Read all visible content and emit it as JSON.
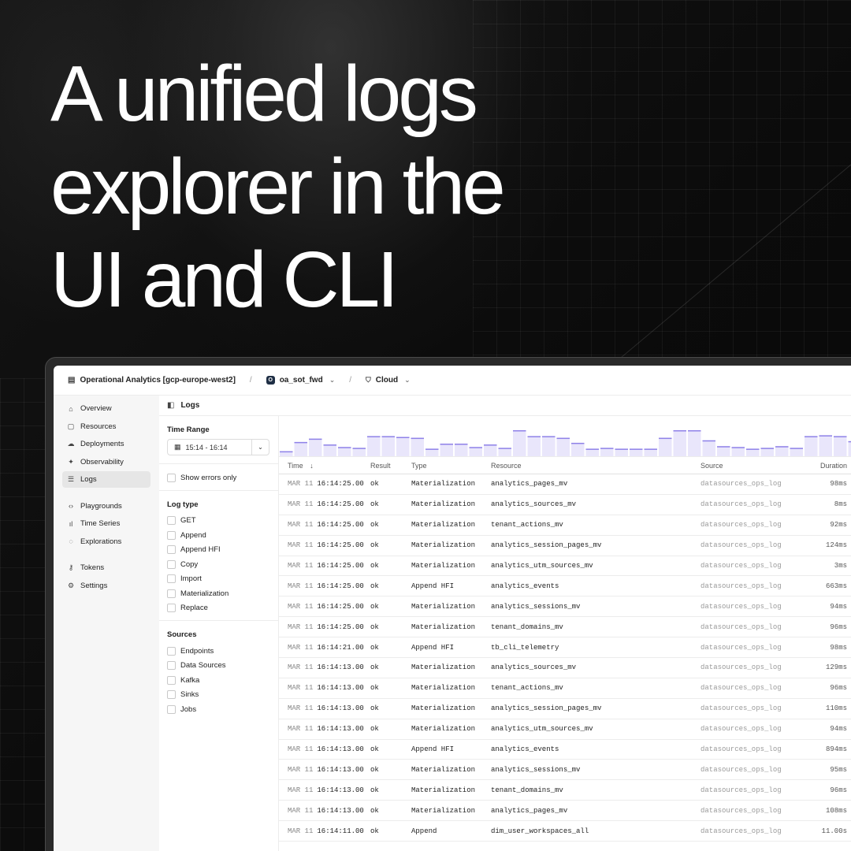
{
  "headline": {
    "line1": "A unified logs",
    "line2": "explorer in the",
    "line3": "UI and CLI"
  },
  "topbar": {
    "workspace": "Operational Analytics [gcp-europe-west2]",
    "separator": "/",
    "branch_badge": "O",
    "branch": "oa_sot_fwd",
    "environment": "Cloud"
  },
  "sidebar": {
    "items": [
      {
        "label": "Overview",
        "icon": "home-icon",
        "glyph": "⌂"
      },
      {
        "label": "Resources",
        "icon": "file-icon",
        "glyph": "▢"
      },
      {
        "label": "Deployments",
        "icon": "cloud-upload-icon",
        "glyph": "☁"
      },
      {
        "label": "Observability",
        "icon": "telescope-icon",
        "glyph": "✦"
      },
      {
        "label": "Logs",
        "icon": "list-check-icon",
        "glyph": "☰"
      },
      {
        "label": "Playgrounds",
        "icon": "code-icon",
        "glyph": "‹›"
      },
      {
        "label": "Time Series",
        "icon": "bar-chart-icon",
        "glyph": "ıl"
      },
      {
        "label": "Explorations",
        "icon": "chat-icon",
        "glyph": "◌"
      },
      {
        "label": "Tokens",
        "icon": "key-icon",
        "glyph": "⚷"
      },
      {
        "label": "Settings",
        "icon": "sliders-icon",
        "glyph": "⚙"
      }
    ],
    "active": "Logs"
  },
  "main": {
    "title": "Logs"
  },
  "filters": {
    "time_range_title": "Time Range",
    "time_range_value": "15:14 - 16:14",
    "show_errors_label": "Show errors only",
    "log_type_title": "Log type",
    "log_types": [
      "GET",
      "Append",
      "Append HFI",
      "Copy",
      "Import",
      "Materialization",
      "Replace"
    ],
    "sources_title": "Sources",
    "sources": [
      "Endpoints",
      "Data Sources",
      "Kafka",
      "Sinks",
      "Jobs"
    ]
  },
  "histogram": {
    "color": "#e9e6fb",
    "edge_color": "#8f82e8",
    "values": [
      6,
      17,
      21,
      14,
      11,
      10,
      24,
      24,
      23,
      22,
      9,
      15,
      15,
      11,
      14,
      10,
      31,
      24,
      24,
      22,
      16,
      9,
      10,
      9,
      9,
      9,
      22,
      31,
      31,
      19,
      12,
      11,
      9,
      10,
      12,
      10,
      24,
      25,
      24,
      18
    ]
  },
  "table": {
    "headers": {
      "time": "Time",
      "sort": "↓",
      "result": "Result",
      "type": "Type",
      "resource": "Resource",
      "source": "Source",
      "duration": "Duration"
    },
    "rows": [
      {
        "month": "MAR 11",
        "time": "16:14:25.00",
        "result": "ok",
        "type": "Materialization",
        "resource": "analytics_pages_mv",
        "source": "datasources_ops_log",
        "duration": "98ms"
      },
      {
        "month": "MAR 11",
        "time": "16:14:25.00",
        "result": "ok",
        "type": "Materialization",
        "resource": "analytics_sources_mv",
        "source": "datasources_ops_log",
        "duration": "8ms"
      },
      {
        "month": "MAR 11",
        "time": "16:14:25.00",
        "result": "ok",
        "type": "Materialization",
        "resource": "tenant_actions_mv",
        "source": "datasources_ops_log",
        "duration": "92ms"
      },
      {
        "month": "MAR 11",
        "time": "16:14:25.00",
        "result": "ok",
        "type": "Materialization",
        "resource": "analytics_session_pages_mv",
        "source": "datasources_ops_log",
        "duration": "124ms"
      },
      {
        "month": "MAR 11",
        "time": "16:14:25.00",
        "result": "ok",
        "type": "Materialization",
        "resource": "analytics_utm_sources_mv",
        "source": "datasources_ops_log",
        "duration": "3ms"
      },
      {
        "month": "MAR 11",
        "time": "16:14:25.00",
        "result": "ok",
        "type": "Append HFI",
        "resource": "analytics_events",
        "source": "datasources_ops_log",
        "duration": "663ms"
      },
      {
        "month": "MAR 11",
        "time": "16:14:25.00",
        "result": "ok",
        "type": "Materialization",
        "resource": "analytics_sessions_mv",
        "source": "datasources_ops_log",
        "duration": "94ms"
      },
      {
        "month": "MAR 11",
        "time": "16:14:25.00",
        "result": "ok",
        "type": "Materialization",
        "resource": "tenant_domains_mv",
        "source": "datasources_ops_log",
        "duration": "96ms"
      },
      {
        "month": "MAR 11",
        "time": "16:14:21.00",
        "result": "ok",
        "type": "Append HFI",
        "resource": "tb_cli_telemetry",
        "source": "datasources_ops_log",
        "duration": "98ms"
      },
      {
        "month": "MAR 11",
        "time": "16:14:13.00",
        "result": "ok",
        "type": "Materialization",
        "resource": "analytics_sources_mv",
        "source": "datasources_ops_log",
        "duration": "129ms"
      },
      {
        "month": "MAR 11",
        "time": "16:14:13.00",
        "result": "ok",
        "type": "Materialization",
        "resource": "tenant_actions_mv",
        "source": "datasources_ops_log",
        "duration": "96ms"
      },
      {
        "month": "MAR 11",
        "time": "16:14:13.00",
        "result": "ok",
        "type": "Materialization",
        "resource": "analytics_session_pages_mv",
        "source": "datasources_ops_log",
        "duration": "110ms"
      },
      {
        "month": "MAR 11",
        "time": "16:14:13.00",
        "result": "ok",
        "type": "Materialization",
        "resource": "analytics_utm_sources_mv",
        "source": "datasources_ops_log",
        "duration": "94ms"
      },
      {
        "month": "MAR 11",
        "time": "16:14:13.00",
        "result": "ok",
        "type": "Append HFI",
        "resource": "analytics_events",
        "source": "datasources_ops_log",
        "duration": "894ms"
      },
      {
        "month": "MAR 11",
        "time": "16:14:13.00",
        "result": "ok",
        "type": "Materialization",
        "resource": "analytics_sessions_mv",
        "source": "datasources_ops_log",
        "duration": "95ms"
      },
      {
        "month": "MAR 11",
        "time": "16:14:13.00",
        "result": "ok",
        "type": "Materialization",
        "resource": "tenant_domains_mv",
        "source": "datasources_ops_log",
        "duration": "96ms"
      },
      {
        "month": "MAR 11",
        "time": "16:14:13.00",
        "result": "ok",
        "type": "Materialization",
        "resource": "analytics_pages_mv",
        "source": "datasources_ops_log",
        "duration": "108ms"
      },
      {
        "month": "MAR 11",
        "time": "16:14:11.00",
        "result": "ok",
        "type": "Append",
        "resource": "dim_user_workspaces_all",
        "source": "datasources_ops_log",
        "duration": "11.00s"
      }
    ]
  }
}
